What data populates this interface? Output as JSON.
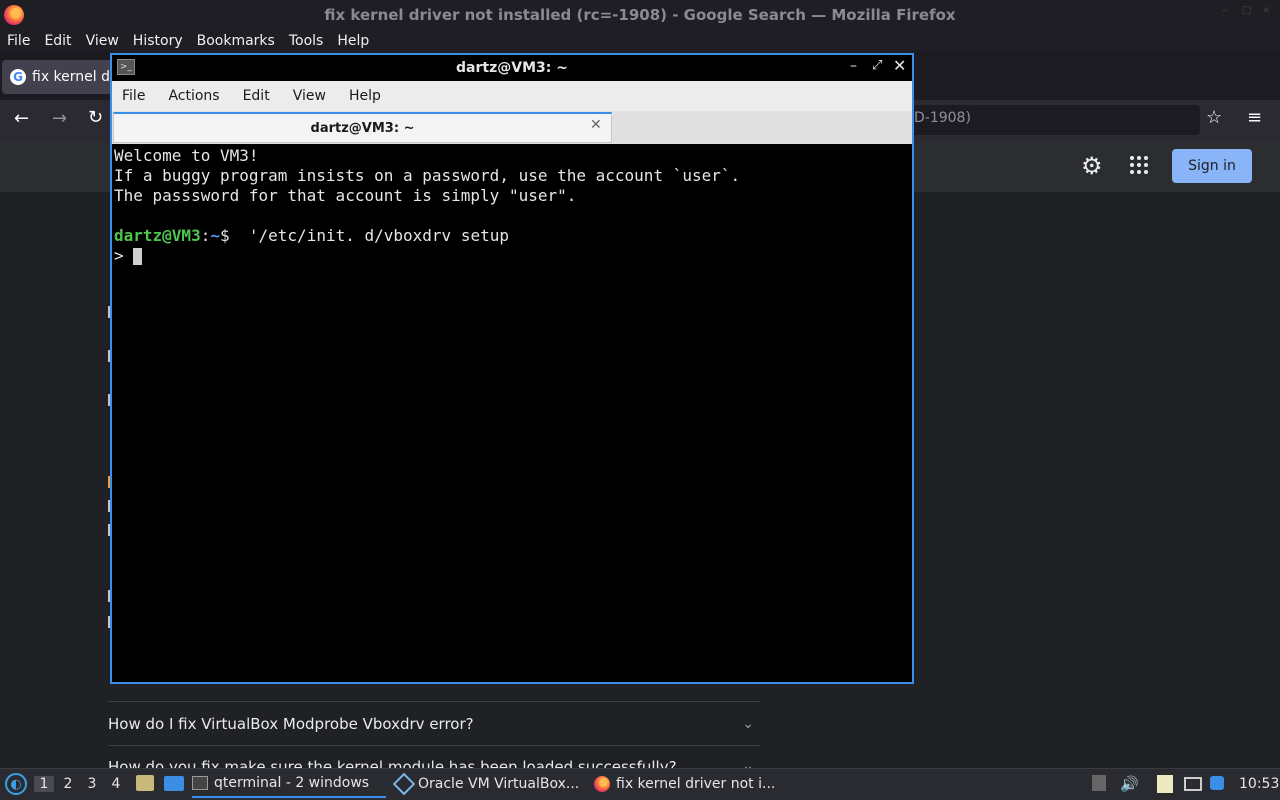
{
  "firefox": {
    "window_title": "fix kernel driver not installed (rc=-1908) - Google Search — Mozilla Firefox",
    "menu": [
      "File",
      "Edit",
      "View",
      "History",
      "Bookmarks",
      "Tools",
      "Help"
    ],
    "tab_title": "fix kernel dr",
    "url_visible_tail": "D-1908)",
    "google": {
      "sign_in": "Sign in",
      "questions": [
        "How do I fix VirtualBox Modprobe Vboxdrv error?",
        "How do you fix make sure the kernel module has been loaded successfully?"
      ]
    }
  },
  "qterminal": {
    "title": "dartz@VM3: ~",
    "menu": [
      "File",
      "Actions",
      "Edit",
      "View",
      "Help"
    ],
    "tab_title": "dartz@VM3: ~",
    "output_lines": [
      "Welcome to VM3!",
      "If a buggy program insists on a password, use the account `user`.",
      "The passsword for that account is simply \"user\"."
    ],
    "prompt_user": "dartz@VM3",
    "prompt_sep": ":",
    "prompt_path": "~",
    "prompt_symbol": "$",
    "command": "  '/etc/init. d/vboxdrv setup",
    "continuation_prompt": "> "
  },
  "taskbar": {
    "workspaces": [
      "1",
      "2",
      "3",
      "4"
    ],
    "tasks": [
      {
        "label": "qterminal - 2 windows",
        "icon": "terminal-icon"
      },
      {
        "label": "Oracle VM VirtualBox...",
        "icon": "virtualbox-icon"
      },
      {
        "label": "fix kernel driver not i...",
        "icon": "firefox-icon"
      }
    ],
    "clock": "10:53"
  }
}
